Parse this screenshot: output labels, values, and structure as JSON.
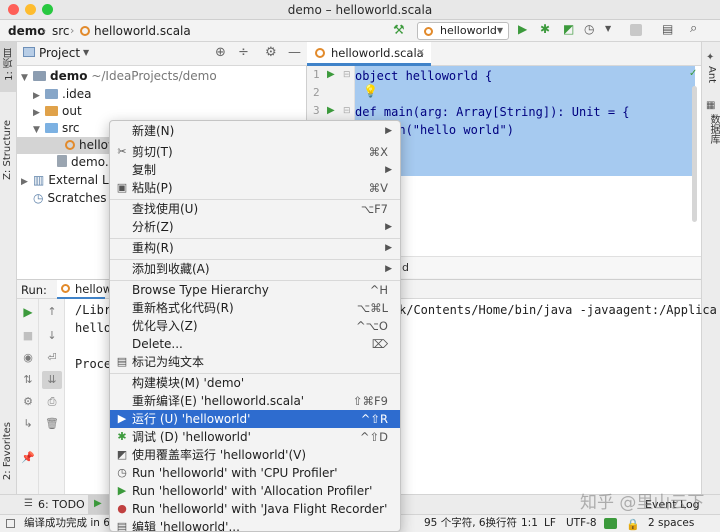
{
  "window": {
    "title": "demo – helloworld.scala"
  },
  "nav": {
    "project": "demo",
    "src": "src",
    "file": "helloworld.scala",
    "run_config": "helloworld"
  },
  "left_stripe": {
    "project_tab": "1: 项目",
    "structure_tab": "Z: Structure",
    "favorites_tab": "2: Favorites"
  },
  "right_stripe": {
    "ant_tab": "Ant",
    "database_tab": "数据库"
  },
  "project_panel": {
    "title": "Project",
    "tree": [
      {
        "label": "demo",
        "suffix": "~/IdeaProjects/demo"
      },
      {
        "label": ".idea"
      },
      {
        "label": "out"
      },
      {
        "label": "src"
      },
      {
        "label": "hellow"
      },
      {
        "label": "demo.im"
      },
      {
        "label": "External Lib"
      },
      {
        "label": "Scratches a"
      }
    ]
  },
  "editor": {
    "tab": "helloworld.scala",
    "line_numbers": [
      "1",
      "2",
      "3",
      "4",
      "5"
    ],
    "code": [
      "object helloworld {",
      "",
      "  def main(arg: Array[String]): Unit = {",
      "    println(\"hello world\")",
      ""
    ],
    "breadcrumb": "ld"
  },
  "run_panel": {
    "label": "Run:",
    "tab": "hellow",
    "console": [
      "/Libr",
      "hello",
      "",
      "Proce"
    ],
    "console_right": "k/Contents/Home/bin/java -javaagent:/Applica"
  },
  "bottom_bar": {
    "todo": "6: TODO",
    "event_log": "Event Log"
  },
  "status_bar": {
    "message": "编译成功完成 in 6 s",
    "chars": "95 个字符, 6换行符",
    "position": "1:1",
    "line_sep": "LF",
    "encoding": "UTF-8",
    "indent": "2 spaces"
  },
  "context_menu": {
    "items": [
      {
        "label": "新建(N)",
        "shortcut": "",
        "submenu": true
      },
      {
        "label": "剪切(T)",
        "shortcut": "⌘X",
        "icon": "✂"
      },
      {
        "label": "复制",
        "shortcut": "",
        "submenu": true
      },
      {
        "label": "粘贴(P)",
        "shortcut": "⌘V",
        "icon": "📋"
      },
      {
        "label": "查找使用(U)",
        "shortcut": "⌥F7"
      },
      {
        "label": "分析(Z)",
        "shortcut": "",
        "submenu": true
      },
      {
        "label": "重构(R)",
        "shortcut": "",
        "submenu": true
      },
      {
        "label": "添加到收藏(A)",
        "shortcut": "",
        "submenu": true
      },
      {
        "label": "Browse Type Hierarchy",
        "shortcut": "^H"
      },
      {
        "label": "重新格式化代码(R)",
        "shortcut": "⌥⌘L"
      },
      {
        "label": "优化导入(Z)",
        "shortcut": "^⌥O"
      },
      {
        "label": "Delete...",
        "shortcut": "⌦"
      },
      {
        "label": "标记为纯文本",
        "shortcut": ""
      },
      {
        "label": "构建模块(M) 'demo'",
        "shortcut": ""
      },
      {
        "label": "重新编译(E) 'helloworld.scala'",
        "shortcut": "⇧⌘F9"
      },
      {
        "label": "运行 (U) 'helloworld'",
        "shortcut": "^⇧R",
        "highlighted": true
      },
      {
        "label": "调试 (D) 'helloworld'",
        "shortcut": "^⇧D"
      },
      {
        "label": "使用覆盖率运行 'helloworld'(V)",
        "shortcut": ""
      },
      {
        "label": "Run 'helloworld' with 'CPU Profiler'",
        "shortcut": ""
      },
      {
        "label": "Run 'helloworld' with 'Allocation Profiler'",
        "shortcut": ""
      },
      {
        "label": "Run 'helloworld' with 'Java Flight Recorder'",
        "shortcut": ""
      },
      {
        "label": "编辑 'helloworld'...",
        "shortcut": ""
      }
    ]
  },
  "watermark": "知乎 @里山云下",
  "colors": {
    "accent": "#2e6ccf",
    "selection": "#a6caf0",
    "run_green": "#3c9a3c",
    "folder": "#87a6c8",
    "src_folder": "#7cb1e2"
  }
}
